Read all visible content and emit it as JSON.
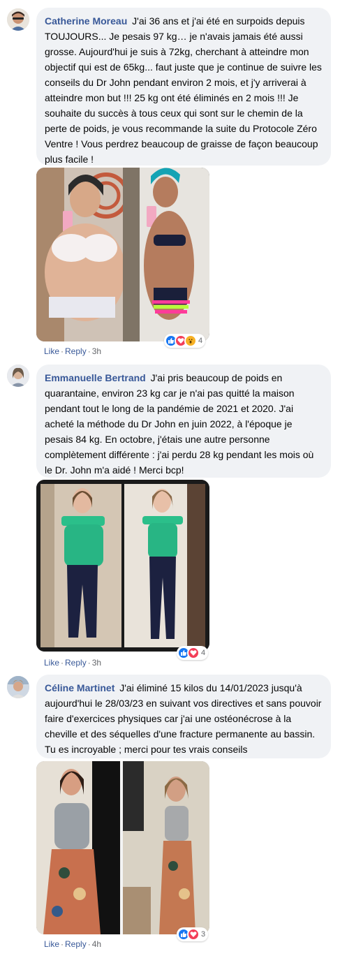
{
  "comments": [
    {
      "author": "Catherine Moreau",
      "text": "J'ai 36 ans et j'ai été en surpoids depuis TOUJOURS... Je pesais 97 kg… je n'avais jamais été aussi grosse. Aujourd'hui je suis à 72kg, cherchant à atteindre mon objectif qui est de 65kg... faut juste que je continue de suivre les conseils du Dr John pendant environ 2 mois, et j'y arriverai à atteindre mon but !!! 25 kg ont été éliminés en 2 mois !!! Je souhaite du succès à tous ceux qui sont sur le chemin de la perte de poids, je vous recommande la suite du Protocole Zéro Ventre ! Vous perdrez beaucoup de graisse de façon beaucoup plus facile !",
      "like_label": "Like",
      "reply_label": "Reply",
      "time": "3h",
      "reaction_icons": [
        "like-icon",
        "love-icon",
        "wow-icon"
      ],
      "reaction_count": "4"
    },
    {
      "author": "Emmanuelle Bertrand",
      "text": "J'ai pris beaucoup de poids en quarantaine, environ 23 kg car je n'ai pas quitté la maison pendant tout le long de la pandémie de 2021 et 2020. J'ai acheté la méthode du Dr John en juin 2022, à l'époque je pesais 84 kg. En octobre, j'étais une autre personne complètement différente : j'ai perdu 28 kg pendant les mois où le Dr. John m'a aidé ! Merci bcp!",
      "like_label": "Like",
      "reply_label": "Reply",
      "time": "3h",
      "reaction_icons": [
        "like-icon",
        "love-icon"
      ],
      "reaction_count": "4"
    },
    {
      "author": "Céline Martinet",
      "text": "J'ai éliminé 15 kilos du 14/01/2023 jusqu'à aujourd'hui le 28/03/23 en suivant vos directives et sans pouvoir faire d'exercices physiques car j'ai une ostéonécrose à la cheville et des séquelles d'une fracture permanente au bassin. Tu es incroyable ; merci pour tes vrais conseils",
      "like_label": "Like",
      "reply_label": "Reply",
      "time": "4h",
      "reaction_icons": [
        "like-icon",
        "love-icon"
      ],
      "reaction_count": "3"
    }
  ],
  "colors": {
    "author": "#385898",
    "bubble": "#f0f2f5",
    "meta": "#65676b",
    "like": "#1877f2",
    "love": "#f33e58",
    "wow": "#f7b125"
  }
}
